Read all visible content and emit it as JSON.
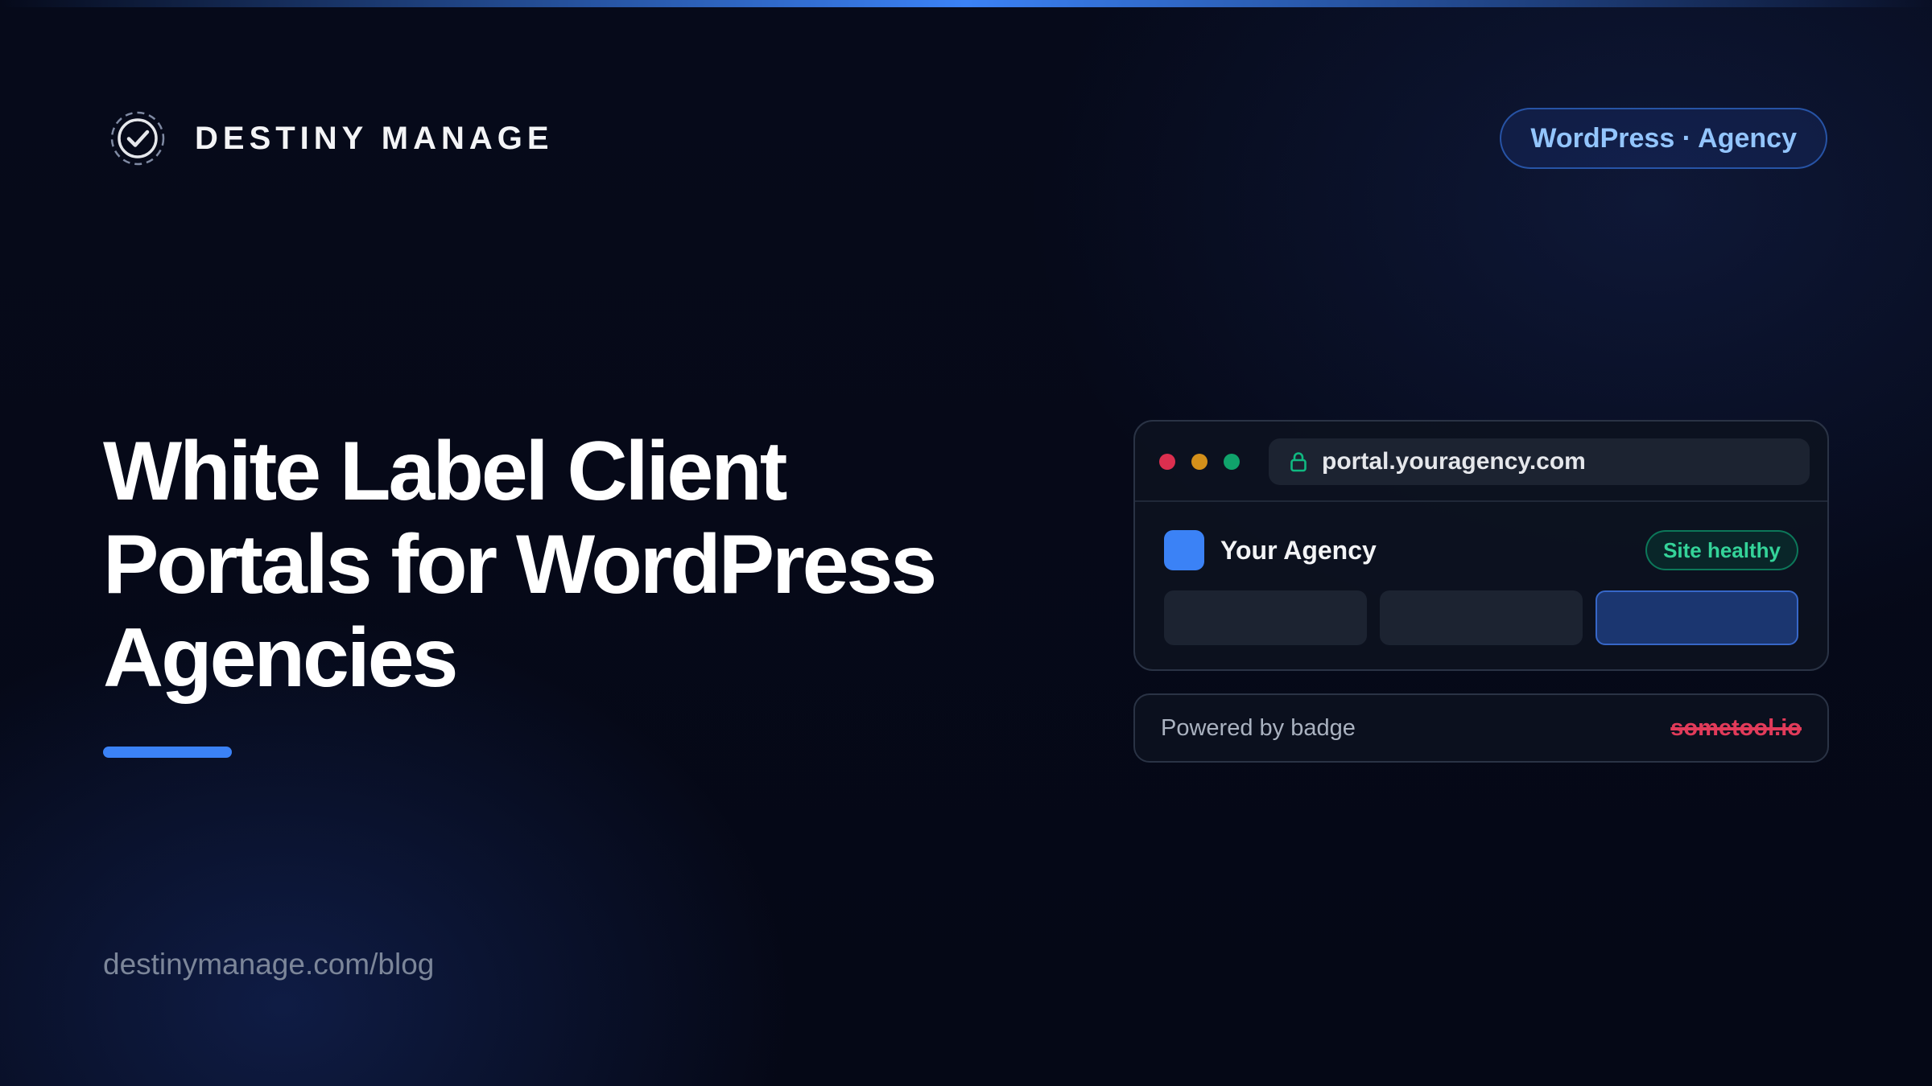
{
  "header": {
    "brand_name": "DESTINY MANAGE",
    "logo_icon": "check-circle-icon",
    "tag": "WordPress · Agency"
  },
  "hero": {
    "headline": "White Label Client Portals for WordPress Agencies"
  },
  "footer": {
    "url": "destinymanage.com/blog"
  },
  "mockup": {
    "url": "portal.youragency.com",
    "lock_icon": "lock-icon",
    "agency_name": "Your Agency",
    "status": "Site healthy",
    "powered_label": "Powered by badge",
    "struck_brand": "sometool.io"
  },
  "colors": {
    "accent": "#3b82f6",
    "background": "#050816",
    "healthy": "#34d399",
    "danger": "#e23b5a"
  }
}
